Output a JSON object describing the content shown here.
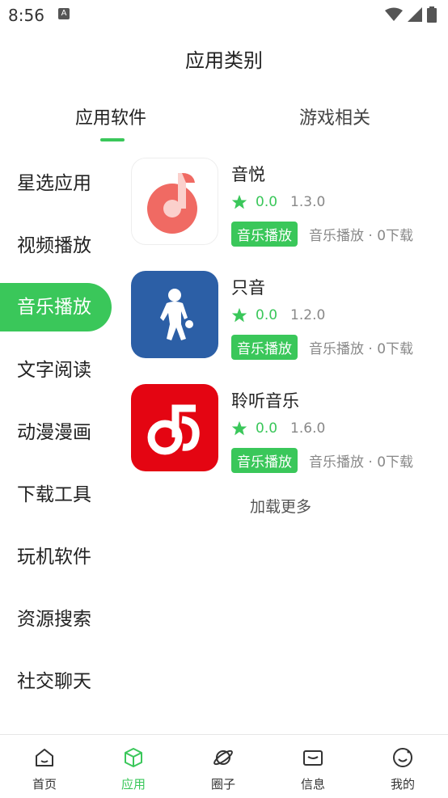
{
  "status_bar": {
    "time": "8:56",
    "notification_glyph": "A"
  },
  "header": {
    "title": "应用类别"
  },
  "tabs": [
    {
      "label": "应用软件",
      "active": true
    },
    {
      "label": "游戏相关",
      "active": false
    }
  ],
  "sidebar": {
    "items": [
      {
        "label": "星选应用"
      },
      {
        "label": "视频播放"
      },
      {
        "label": "音乐播放",
        "active": true
      },
      {
        "label": "文字阅读"
      },
      {
        "label": "动漫漫画"
      },
      {
        "label": "下载工具"
      },
      {
        "label": "玩机软件"
      },
      {
        "label": "资源搜索"
      },
      {
        "label": "社交聊天"
      }
    ]
  },
  "apps": [
    {
      "name": "音悦",
      "rating": "0.0",
      "version": "1.3.0",
      "tag": "音乐播放",
      "meta": "音乐播放 · 0下载",
      "icon": "music-note-disc-icon"
    },
    {
      "name": "只音",
      "rating": "0.0",
      "version": "1.2.0",
      "tag": "音乐播放",
      "meta": "音乐播放 · 0下载",
      "icon": "basketball-player-icon"
    },
    {
      "name": "聆听音乐",
      "rating": "0.0",
      "version": "1.6.0",
      "tag": "音乐播放",
      "meta": "音乐播放 · 0下载",
      "icon": "red-music-note-icon"
    }
  ],
  "load_more": "加载更多",
  "bottom_nav": [
    {
      "label": "首页",
      "icon": "home-icon"
    },
    {
      "label": "应用",
      "icon": "cube-icon",
      "active": true
    },
    {
      "label": "圈子",
      "icon": "planet-icon"
    },
    {
      "label": "信息",
      "icon": "mail-icon"
    },
    {
      "label": "我的",
      "icon": "smile-icon"
    }
  ],
  "colors": {
    "accent": "#3ac75a",
    "text": "#222222",
    "muted": "#888888",
    "app1_bg": "#f06a63",
    "app2_bg": "#2c5fa6",
    "app3_bg": "#e40512"
  }
}
